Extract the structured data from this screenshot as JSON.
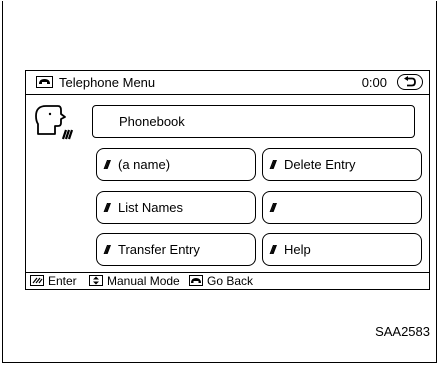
{
  "screen": {
    "title": "Telephone Menu",
    "clock": "0:00",
    "phonebook_label": "Phonebook",
    "buttons": [
      {
        "label": "(a name)"
      },
      {
        "label": "Delete Entry"
      },
      {
        "label": "List Names"
      },
      {
        "label": ""
      },
      {
        "label": "Transfer Entry"
      },
      {
        "label": "Help"
      }
    ],
    "footer": {
      "enter": "Enter",
      "manual_mode": "Manual Mode",
      "go_back": "Go Back"
    }
  },
  "figure_code": "SAA2583"
}
